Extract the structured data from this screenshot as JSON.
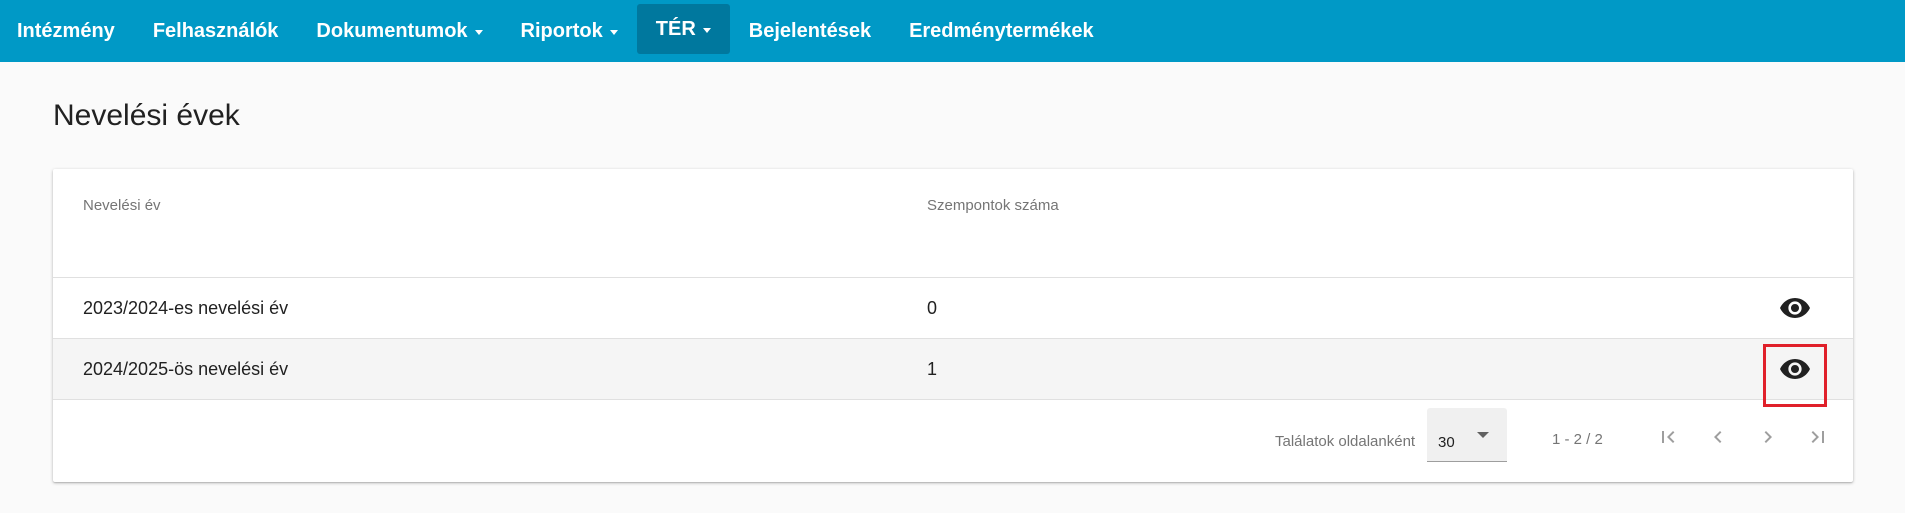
{
  "nav": {
    "items": [
      {
        "label": "Intézmény"
      },
      {
        "label": "Felhasználók"
      },
      {
        "label": "Dokumentumok"
      },
      {
        "label": "Riportok"
      },
      {
        "label": "TÉR"
      },
      {
        "label": "Bejelentések"
      },
      {
        "label": "Eredménytermékek"
      }
    ]
  },
  "page": {
    "title": "Nevelési évek"
  },
  "table": {
    "headers": [
      "Nevelési év",
      "Szempontok száma"
    ],
    "rows": [
      {
        "year": "2023/2024-es nevelési év",
        "count": "0",
        "action_icon": "eye-icon"
      },
      {
        "year": "2024/2025-ös nevelési év",
        "count": "1",
        "action_icon": "eye-icon"
      }
    ]
  },
  "paginator": {
    "per_page_label": "Találatok oldalanként",
    "per_page_value": "30",
    "range": "1 - 2 / 2"
  },
  "colors": {
    "nav_bg": "#0099c6",
    "nav_active_bg": "#00789e",
    "highlight": "#e0202a"
  }
}
